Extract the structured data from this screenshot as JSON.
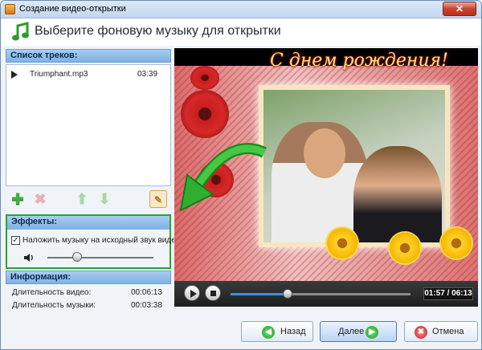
{
  "window": {
    "title": "Создание видео-открытки",
    "close_glyph": "✕"
  },
  "header": {
    "title": "Выберите фоновую музыку для открытки",
    "icon": "music-note-icon"
  },
  "tracks": {
    "heading": "Список треков:",
    "items": [
      {
        "name": "Triumphant.mp3",
        "duration": "03:39"
      }
    ]
  },
  "tools": {
    "add": "✚",
    "delete": "✖",
    "up": "⬆",
    "down": "⬇",
    "edit": "✎"
  },
  "effects": {
    "heading": "Эффекты:",
    "overlay_checked": true,
    "overlay_label": "Наложить музыку на исходный звук видео",
    "check_glyph": "✓",
    "volume_level": 0.28
  },
  "info": {
    "heading": "Информация:",
    "video_label": "Длительность видео:",
    "video_value": "00:06:13",
    "music_label": "Длительность музыки:",
    "music_value": "00:03:38"
  },
  "player": {
    "greeting": "С днем рождения!",
    "progress": 0.318,
    "time_display": "01:57 / 06:13"
  },
  "footer": {
    "back_label": "Назад",
    "next_label": "Далее",
    "cancel_label": "Отмена",
    "back_glyph": "◀",
    "next_glyph": "▶",
    "cancel_glyph": "✖"
  },
  "colors": {
    "accent": "#3d8fe0",
    "highlight_border": "#2aa52a",
    "panel_head": "#7fb1e3"
  }
}
